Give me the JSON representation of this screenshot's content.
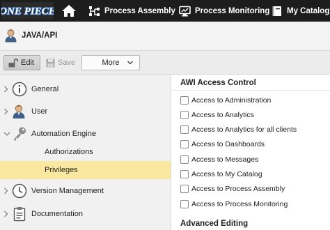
{
  "topbar": {
    "logo_text": "ONE PIECE",
    "items": [
      {
        "label": "Process Assembly"
      },
      {
        "label": "Process Monitoring"
      },
      {
        "label": "My Catalog"
      }
    ]
  },
  "object": {
    "title": "JAVA/API"
  },
  "toolbar": {
    "edit_label": "Edit",
    "save_label": "Save",
    "more_label": "More"
  },
  "leftnav": {
    "items": [
      {
        "label": "General"
      },
      {
        "label": "User"
      },
      {
        "label": "Automation Engine"
      },
      {
        "label": "Version Management"
      },
      {
        "label": "Documentation"
      }
    ],
    "subitems": [
      {
        "label": "Authorizations"
      },
      {
        "label": "Privileges",
        "selected": true
      }
    ]
  },
  "content": {
    "section_title": "AWI Access Control",
    "checkboxes": [
      {
        "label": "Access to Administration",
        "checked": false
      },
      {
        "label": "Access to Analytics",
        "checked": false
      },
      {
        "label": "Access to Analytics for all clients",
        "checked": false
      },
      {
        "label": "Access to Dashboards",
        "checked": false
      },
      {
        "label": "Access to Messages",
        "checked": false
      },
      {
        "label": "Access to My Catalog",
        "checked": false
      },
      {
        "label": "Access to Process Assembly",
        "checked": false
      },
      {
        "label": "Access to Process Monitoring",
        "checked": false
      }
    ],
    "section2_title": "Advanced Editing"
  },
  "colors": {
    "topbar_bg": "#1d1d1d",
    "selected_row": "#fbe8a0",
    "logo_blue": "#3a78c9"
  }
}
